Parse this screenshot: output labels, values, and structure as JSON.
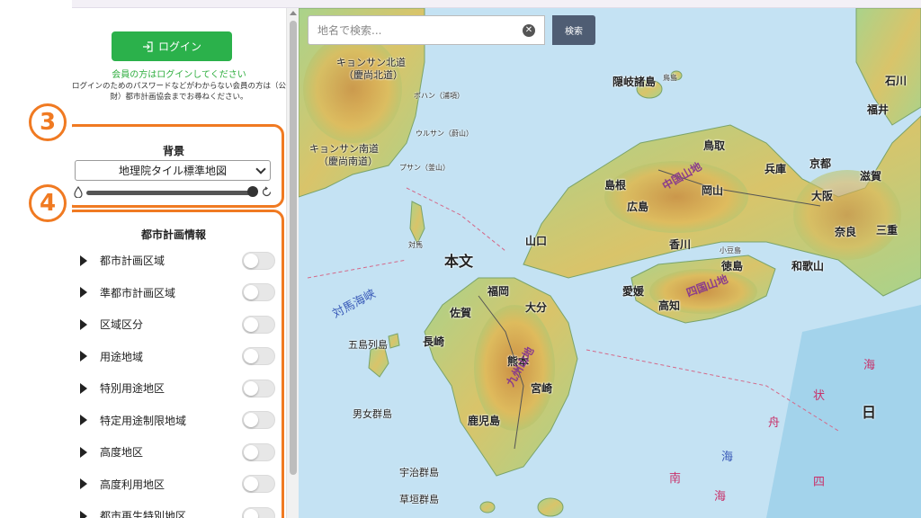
{
  "sidebar": {
    "login_button": "ログイン",
    "login_note": "会員の方はログインしてください",
    "login_help_1": "ログインのためのパスワードなどがわからない会員の方は（公",
    "login_help_2": "財）都市計画協会までお尋ねください。",
    "badge_3": "3",
    "badge_4": "4",
    "background": {
      "title": "背景",
      "selected": "地理院タイル標準地図",
      "opacity_percent": 100
    },
    "city_planning": {
      "title": "都市計画情報",
      "layers": [
        {
          "label": "都市計画区域",
          "on": false
        },
        {
          "label": "準都市計画区域",
          "on": false
        },
        {
          "label": "区域区分",
          "on": false
        },
        {
          "label": "用途地域",
          "on": false
        },
        {
          "label": "特別用途地区",
          "on": false
        },
        {
          "label": "特定用途制限地域",
          "on": false
        },
        {
          "label": "高度地区",
          "on": false
        },
        {
          "label": "高度利用地区",
          "on": false
        },
        {
          "label": "都市再生特別地区",
          "on": false
        }
      ]
    }
  },
  "map": {
    "search_placeholder": "地名で検索...",
    "search_button": "検索",
    "labels": {
      "kyongsang_n": "キョンサン北道",
      "kyongsang_n_kanji": "（慶尚北道）",
      "kyongsang_s": "キョンサン南道",
      "kyongsang_s_kanji": "（慶尚南道）",
      "pohang": "ポハン（浦項）",
      "ulsan": "ウルサン（蔚山）",
      "busan": "プサン（釜山）",
      "oki": "隠岐諸島",
      "tsushima": "対馬",
      "honshu": "本文",
      "tsushima_strait": "対馬海峡",
      "goto": "五島列島",
      "dansyo": "男女群島",
      "uji": "宇治群島",
      "kusagaki": "草垣群島",
      "tottori": "鳥取",
      "shimane": "島根",
      "hiroshima": "広島",
      "okayama": "岡山",
      "hyogo": "兵庫",
      "kyoto": "京都",
      "shiga": "滋賀",
      "osaka": "大阪",
      "nara": "奈良",
      "mie": "三重",
      "wakayama": "和歌山",
      "ishikawa": "石川",
      "fukui": "福井",
      "yamaguchi": "山口",
      "kagawa": "香川",
      "tokushima": "徳島",
      "ehime": "愛媛",
      "kochi": "高知",
      "fukuoka": "福岡",
      "saga": "佐賀",
      "oita": "大分",
      "nagasaki": "長崎",
      "kumamoto": "熊本",
      "miyazaki": "宮崎",
      "kagoshima": "鹿児島",
      "chugoku_mts": "中国山地",
      "shikoku_mts": "四国山地",
      "kyushu_mts": "九州山地",
      "nankai_trough_1": "南",
      "nankai_trough_2": "海",
      "nankai_trough_3": "四",
      "boat_1": "舟",
      "boat_2": "状",
      "boat_3": "海",
      "nichi": "日",
      "kai": "海",
      "island_peak": "鳥島",
      "shodo": "小豆島"
    }
  },
  "colors": {
    "accent_orange": "#f07a22",
    "login_green": "#2bb14b",
    "search_button": "#4f5d73",
    "sea": "#c4e2f3"
  }
}
